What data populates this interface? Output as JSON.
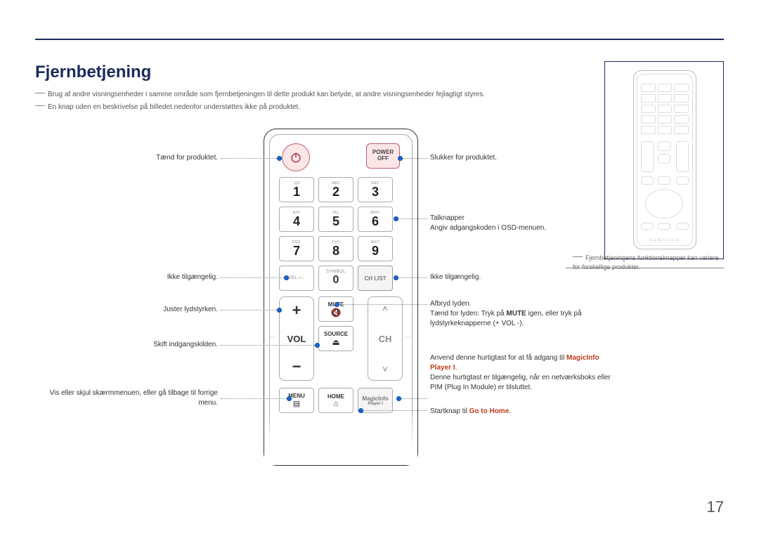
{
  "title": "Fjernbetjening",
  "notes": {
    "n1": "Brug af andre visningsenheder i samme område som fjernbetjeningen til dette produkt kan betyde, at andre visningsenheder fejlagtigt styres.",
    "n2": "En knap uden en beskrivelse på billedet nedenfor understøttes ikke på produktet."
  },
  "remote": {
    "power_off_line1": "POWER",
    "power_off_line2": "OFF",
    "keys": [
      {
        "sub": ".QZ",
        "num": "1"
      },
      {
        "sub": "ABC",
        "num": "2"
      },
      {
        "sub": "DEF",
        "num": "3"
      },
      {
        "sub": "GHI",
        "num": "4"
      },
      {
        "sub": "JKL",
        "num": "5"
      },
      {
        "sub": "MNO",
        "num": "6"
      },
      {
        "sub": "PRS",
        "num": "7"
      },
      {
        "sub": "TUV",
        "num": "8"
      },
      {
        "sub": "WXY",
        "num": "9"
      }
    ],
    "row4": {
      "del": "DEL-/--",
      "sym_top": "SYMBOL",
      "sym_num": "0",
      "chlist": "CH LIST"
    },
    "vol": {
      "plus": "+",
      "label": "VOL",
      "minus": "−"
    },
    "ch": {
      "up": "˄",
      "label": "CH",
      "down": "˅"
    },
    "mid": {
      "mute": "MUTE",
      "source": "SOURCE"
    },
    "bottom": {
      "menu": "MENU",
      "home": "HOME",
      "magic1": "MagicInfo",
      "magic2": "Player I"
    }
  },
  "callouts": {
    "left": {
      "power_on": "Tænd for produktet.",
      "na1": "Ikke tilgængelig.",
      "vol": "Juster lydstyrken.",
      "source": "Skift indgangskilden.",
      "menu": "Vis eller skjul skærmmenuen, eller gå tilbage til forrige menu."
    },
    "right": {
      "power_off": "Slukker for produktet.",
      "numbers_l1": "Talknapper",
      "numbers_l2": "Angiv adgangskoden i OSD-menuen.",
      "na2": "Ikke tilgængelig.",
      "mute_l1": "Afbryd lyden.",
      "mute_l2_a": "Tænd for lyden: Tryk på ",
      "mute_bold": "MUTE",
      "mute_l2_b": " igen, eller tryk på lydstyrkeknapperne (+ VOL -).",
      "magic_l1": "Anvend denne hurtigtast for at få adgang til ",
      "magic_red": "MagicInfo Player I",
      "magic_dot": ".",
      "magic_l2": "Denne hurtigtast er tilgængelig, når en netværksboks eller PIM (Plug In Module) er tilsluttet.",
      "home_a": "Startknap til ",
      "home_red": "Go to Home",
      "home_dot": "."
    }
  },
  "sidebar": {
    "note": "Fjernbetjeningens funktionsknapper kan variere for forskellige produkter.",
    "brand": "SAMSUNG"
  },
  "page_number": "17"
}
